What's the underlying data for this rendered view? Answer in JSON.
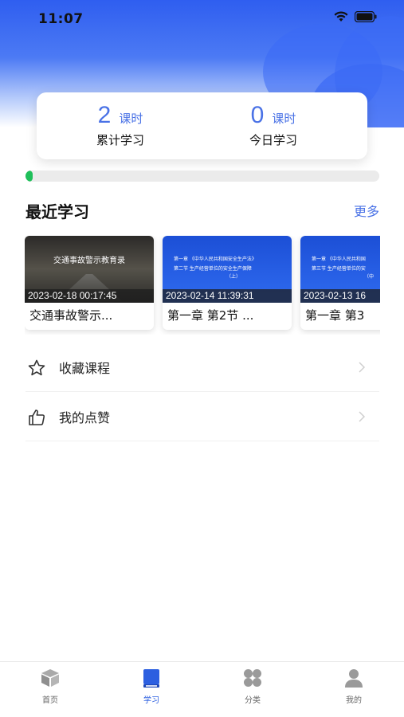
{
  "status_bar": {
    "time": "11:07"
  },
  "stats": {
    "total": {
      "value": "2",
      "unit": "课时",
      "label": "累计学习"
    },
    "today": {
      "value": "0",
      "unit": "课时",
      "label": "今日学习"
    }
  },
  "progress": {
    "value": 0.02
  },
  "recent": {
    "title": "最近学习",
    "more_label": "更多",
    "items": [
      {
        "date": "2023-02-18 00:17:45",
        "title": "交通事故警示...",
        "thumb_heading": "交通事故警示教育录",
        "thumb_lines": [],
        "theme": "dark"
      },
      {
        "date": "2023-02-14 11:39:31",
        "title": "第一章 第2节 ...",
        "thumb_heading": "",
        "thumb_lines": [
          "第一章  《中华人民共和国安全生产法》",
          "第二节  生产经营单位的安全生产保障",
          "（上）"
        ],
        "theme": "blue"
      },
      {
        "date": "2023-02-13 16",
        "title": "第一章 第3",
        "thumb_heading": "",
        "thumb_lines": [
          "第一章  《中华人民共和国",
          "第三节  生产经营单位的安",
          "（中"
        ],
        "theme": "blue"
      }
    ]
  },
  "menu": {
    "favorites_label": "收藏课程",
    "likes_label": "我的点赞"
  },
  "tabbar": {
    "home": "首页",
    "study": "学习",
    "category": "分类",
    "mine": "我的"
  },
  "colors": {
    "accent": "#4a72e6",
    "tab_active": "#2c5fe0",
    "progress": "#1fbf5a"
  }
}
